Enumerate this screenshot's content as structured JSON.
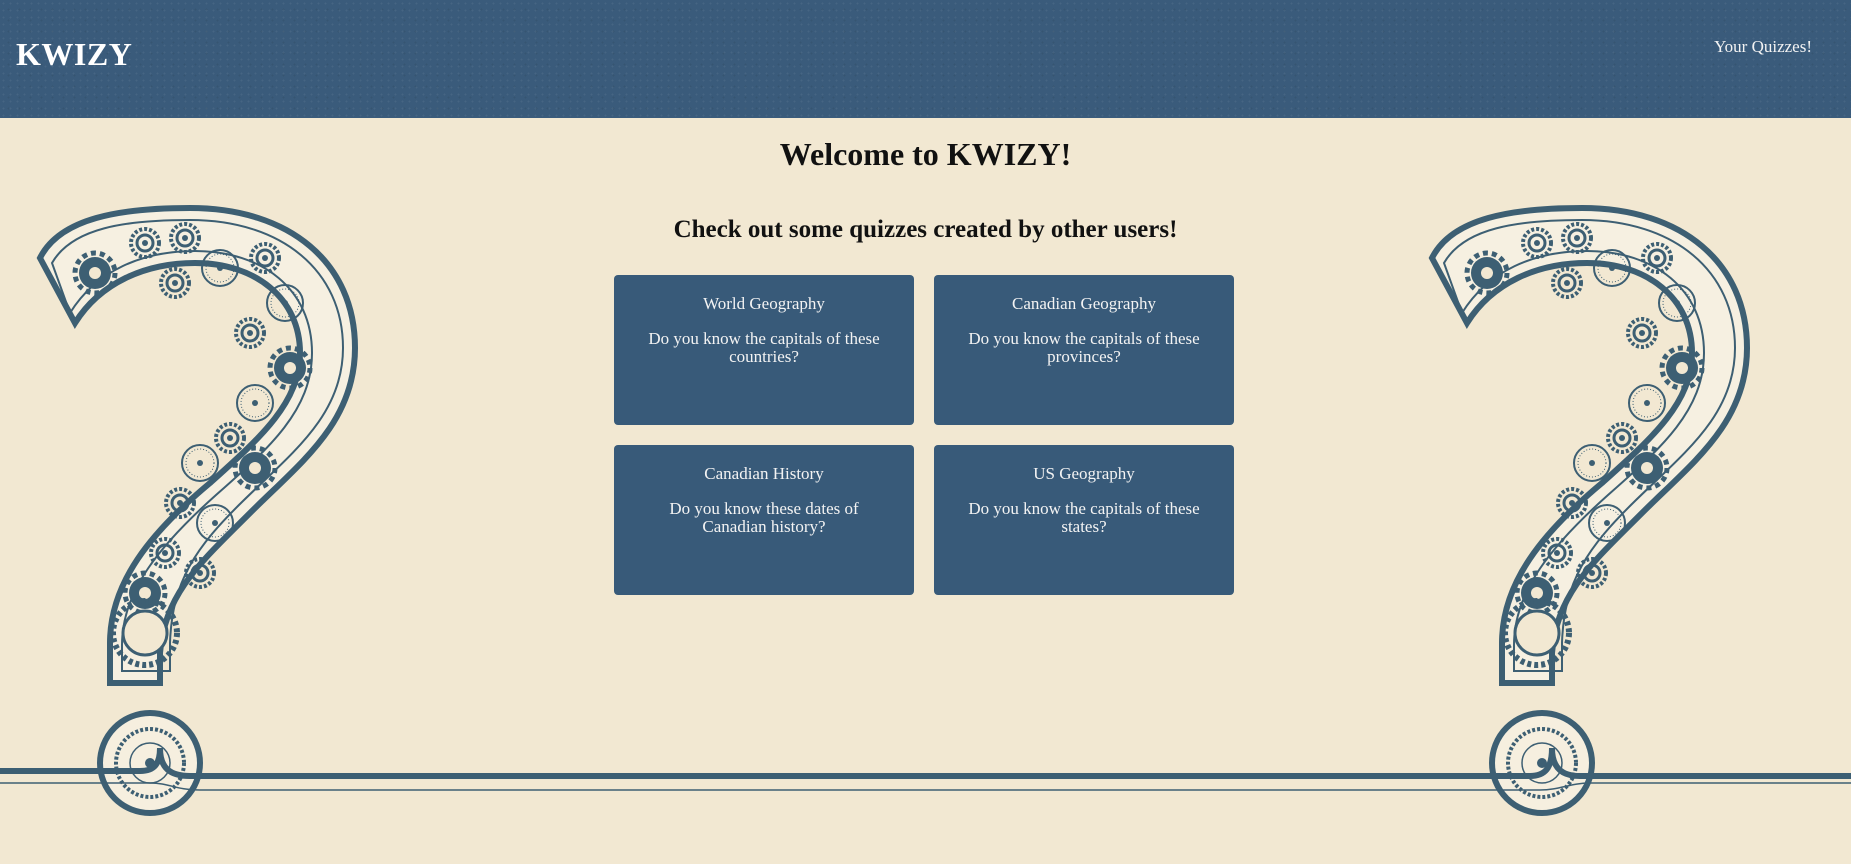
{
  "header": {
    "brand": "KWIZY",
    "nav_link": "Your Quizzes!"
  },
  "main": {
    "welcome": "Welcome to KWIZY!",
    "subtitle": "Check out some quizzes created by other users!"
  },
  "quizzes": [
    {
      "title": "World Geography",
      "description": "Do you know the capitals of these countries?"
    },
    {
      "title": "Canadian Geography",
      "description": "Do you know the capitals of these provinces?"
    },
    {
      "title": "Canadian History",
      "description": "Do you know these dates of Canadian history?"
    },
    {
      "title": "US Geography",
      "description": "Do you know the capitals of these states?"
    }
  ],
  "colors": {
    "header_bg": "#3a5b7b",
    "page_bg": "#f2e8d2",
    "card_bg": "#385a79",
    "art_stroke": "#3d5f73"
  },
  "icons": {
    "background_art": "question-mark-gears-icon"
  }
}
